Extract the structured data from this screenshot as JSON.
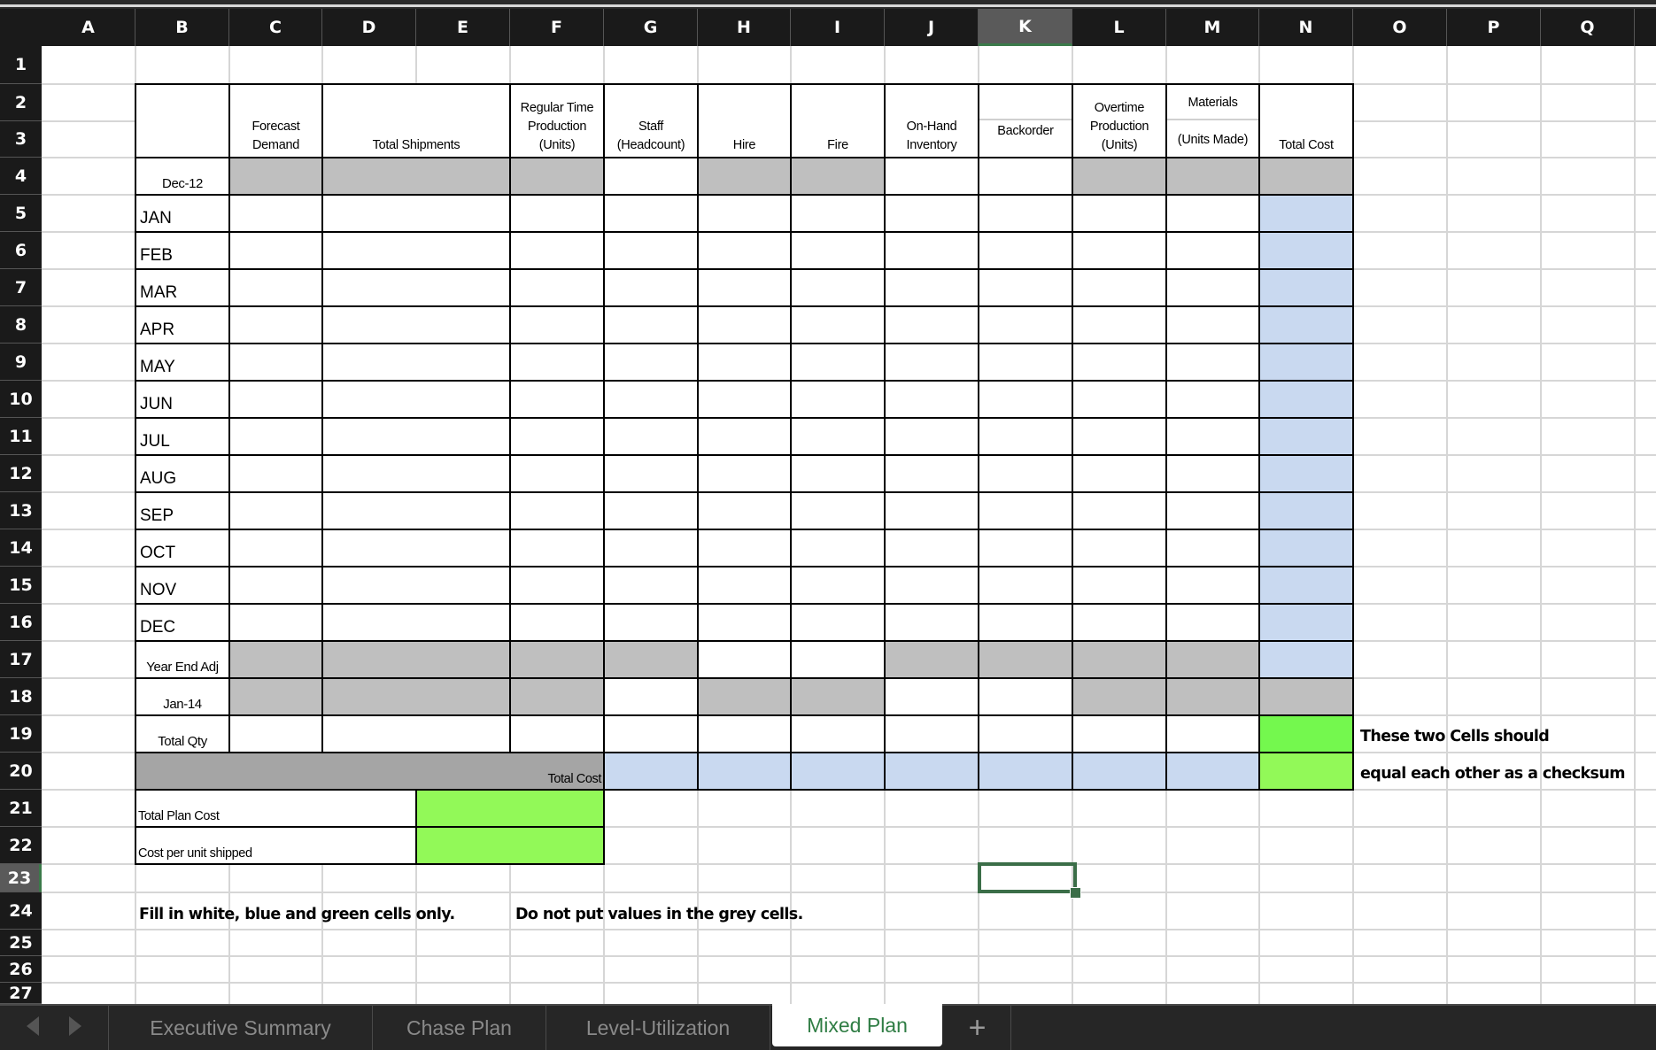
{
  "column_headers": [
    "A",
    "B",
    "C",
    "D",
    "E",
    "F",
    "G",
    "H",
    "I",
    "J",
    "K",
    "L",
    "M",
    "N",
    "O",
    "P",
    "Q"
  ],
  "selected_column": "K",
  "row_headers": [
    "1",
    "2",
    "3",
    "4",
    "5",
    "6",
    "7",
    "8",
    "9",
    "10",
    "11",
    "12",
    "13",
    "14",
    "15",
    "16",
    "17",
    "18",
    "19",
    "20",
    "21",
    "22",
    "23",
    "24",
    "25",
    "26",
    "27"
  ],
  "selected_row": "23",
  "selected_cell": "K23",
  "table": {
    "headers": {
      "forecast_demand": "Forecast Demand",
      "total_shipments": "Total Shipments",
      "regular_time_production": "Regular Time Production (Units)",
      "staff": "Staff (Headcount)",
      "hire": "Hire",
      "fire": "Fire",
      "on_hand_inventory": "On-Hand Inventory",
      "backorder": "Backorder",
      "overtime_production": "Overtime Production (Units)",
      "materials_top": "Materials",
      "materials_bottom": "(Units Made)",
      "total_cost": "Total Cost"
    },
    "row_labels": {
      "start": "Dec-12",
      "months": [
        "JAN",
        "FEB",
        "MAR",
        "APR",
        "MAY",
        "JUN",
        "JUL",
        "AUG",
        "SEP",
        "OCT",
        "NOV",
        "DEC"
      ],
      "year_end_adj": "Year End Adj",
      "end": "Jan-14",
      "total_qty": "Total Qty",
      "total_cost": "Total Cost"
    },
    "summary": {
      "total_plan_cost_label": "Total Plan Cost",
      "cost_per_unit_label": "Cost per unit shipped",
      "total_plan_cost_value": "",
      "cost_per_unit_value": ""
    }
  },
  "notes": {
    "checksum_line1": "These two Cells should",
    "checksum_line2": "equal each other as a checksum",
    "instruction_fill": "Fill in white, blue and green cells only.",
    "instruction_grey": "Do not put values in the grey cells."
  },
  "sheet_tabs": [
    {
      "label": "Executive Summary",
      "active": false
    },
    {
      "label": "Chase Plan",
      "active": false
    },
    {
      "label": "Level-Utilization",
      "active": false
    },
    {
      "label": "Mixed Plan",
      "active": true
    }
  ],
  "add_sheet_label": "+",
  "colors": {
    "grey_cell": "#bfbfbf",
    "blue_cell": "#c9d9f0",
    "green_cell": "#74f84e",
    "selection": "#3b6e48",
    "active_tab_text": "#2f7d44"
  }
}
